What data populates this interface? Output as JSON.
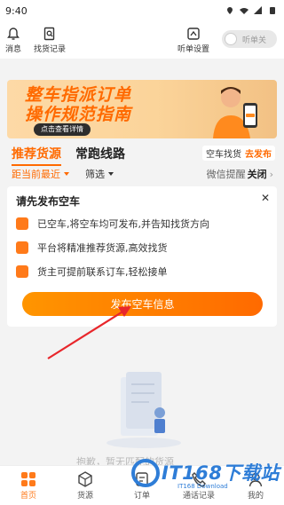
{
  "status_bar": {
    "time": "9:40"
  },
  "toolbar": {
    "messages_label": "消息",
    "search_history_label": "找货记录",
    "listen_settings_label": "听单设置",
    "listen_toggle_label": "听单关"
  },
  "banner": {
    "line1": "整车指派订单",
    "line2": "操作规范指南",
    "detail_button": "点击查看详情"
  },
  "tabs": [
    {
      "label": "推荐货源"
    },
    {
      "label": "常跑线路"
    }
  ],
  "find_car": {
    "label": "空车找货",
    "action": "去发布"
  },
  "filters": [
    {
      "label": "距当前最近"
    },
    {
      "label": "筛选"
    }
  ],
  "wechat_remind": {
    "label": "微信提醒",
    "value": "关闭",
    "chevron": "›"
  },
  "card": {
    "title": "请先发布空车",
    "close": "✕",
    "items": [
      {
        "text": "已空车,将空车均可发布,并告知找货方向"
      },
      {
        "text": "平台将精准推荐货源,高效找货"
      },
      {
        "text": "货主可提前联系订车,轻松接单"
      }
    ],
    "cta": "发布空车信息"
  },
  "empty_state": {
    "text": "抱歉，暂无匹配的货源"
  },
  "bottom_nav": [
    {
      "label": "首页",
      "icon": "home-grid-icon"
    },
    {
      "label": "货源",
      "icon": "cube-icon"
    },
    {
      "label": "订单",
      "icon": "order-icon"
    },
    {
      "label": "通话记录",
      "icon": "phone-icon"
    },
    {
      "label": "我的",
      "icon": "user-icon"
    }
  ],
  "watermark": {
    "brand": "IT168下载站",
    "sub": "IT168 Download"
  },
  "colors": {
    "accent": "#ff6a00",
    "watermark": "#2e7dd7"
  }
}
